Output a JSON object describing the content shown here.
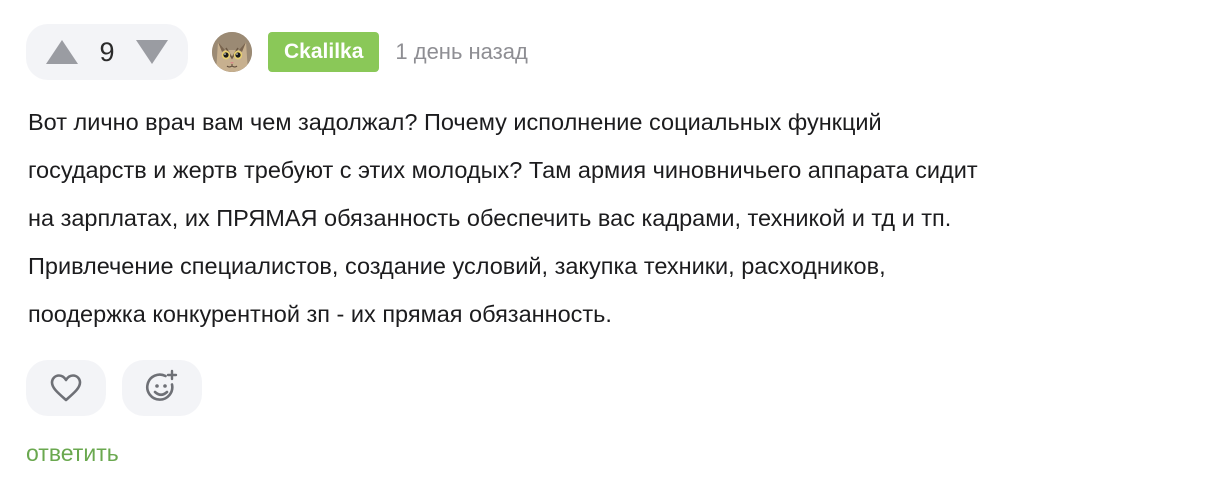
{
  "vote": {
    "count": "9",
    "up_icon": "triangle-up-icon",
    "down_icon": "triangle-down-icon"
  },
  "author": {
    "name": "Ckalilka",
    "avatar": "cat-avatar",
    "badge_color": "#8ac858"
  },
  "time": "1 день назад",
  "comment": {
    "lines": [
      "Вот лично врач вам чем задолжал? Почему исполнение социальных функций",
      "государств и жертв требуют с этих молодых? Там армия чиновничьего аппарата сидит",
      "на зарплатах, их ПРЯМАЯ обязанность обеспечить вас кадрами, техникой и тд и тп.",
      "Привлечение специалистов, создание условий, закупка техники, расходников,",
      "поодержка конкурентной зп - их прямая обязанность."
    ]
  },
  "actions": {
    "like_icon": "heart-icon",
    "reaction_icon": "add-reaction-icon"
  },
  "reply_label": "ответить",
  "colors": {
    "accent": "#6aa84f",
    "pill_bg": "#f3f4f7",
    "icon_gray": "#9a9ca2"
  }
}
